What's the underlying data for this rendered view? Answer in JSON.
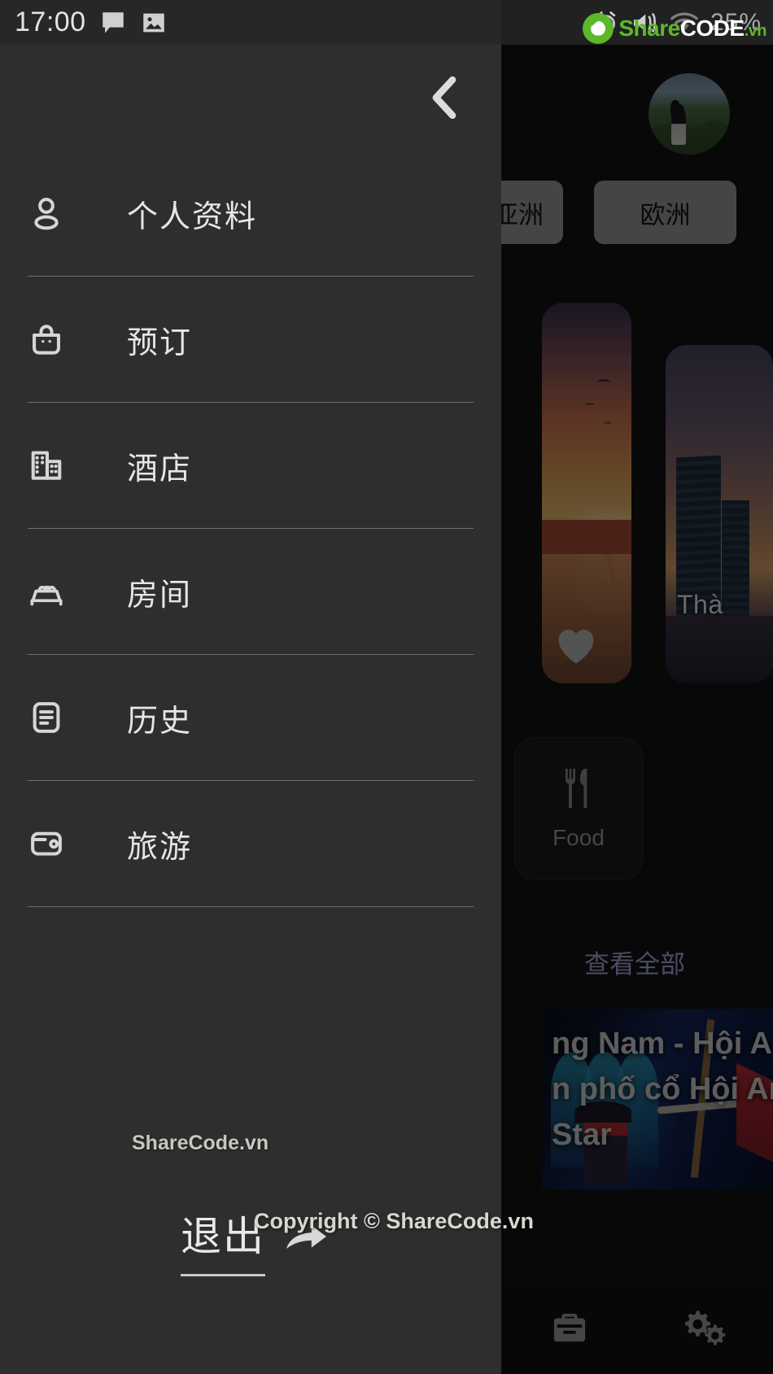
{
  "statusbar": {
    "time": "17:00",
    "left_icons": [
      "message-icon",
      "image-icon"
    ],
    "right_icons": [
      "alarm-icon",
      "vibrate-icon",
      "wifi-icon"
    ],
    "battery_text": "25%"
  },
  "watermark": {
    "logo_share": "Share",
    "logo_code": "CODE",
    "logo_vn": ".vn",
    "site": "ShareCode.vn",
    "copyright": "Copyright © ShareCode.vn"
  },
  "drawer": {
    "back_icon": "chevron-left-icon",
    "items": [
      {
        "label": "个人资料",
        "icon": "person-icon"
      },
      {
        "label": "预订",
        "icon": "bag-icon"
      },
      {
        "label": "酒店",
        "icon": "building-icon"
      },
      {
        "label": "房间",
        "icon": "bed-icon"
      },
      {
        "label": "历史",
        "icon": "document-icon"
      },
      {
        "label": "旅游",
        "icon": "wallet-icon"
      }
    ],
    "logout_label": "退出",
    "logout_icon": "logout-arrow-icon"
  },
  "app": {
    "chips": [
      {
        "label": "亚洲"
      },
      {
        "label": "欧洲"
      }
    ],
    "cards": [
      {
        "title": "",
        "icon": "heart-icon"
      },
      {
        "title": "Thà"
      }
    ],
    "categories": [
      {
        "label": "Food",
        "icon": "food-icon"
      }
    ],
    "see_all": "查看全部",
    "news": {
      "title": "ng Nam - Hội A",
      "subtitle": "n phố cổ Hội An",
      "extra": "Star"
    },
    "bottom_nav": [
      {
        "icon": "briefcase-icon"
      },
      {
        "icon": "settings-gears-icon"
      }
    ]
  },
  "colors": {
    "drawer_bg": "#2e2e2e",
    "app_bg": "#121212",
    "accent_link": "#a5a8d8",
    "brand_green": "#5cb82b"
  }
}
